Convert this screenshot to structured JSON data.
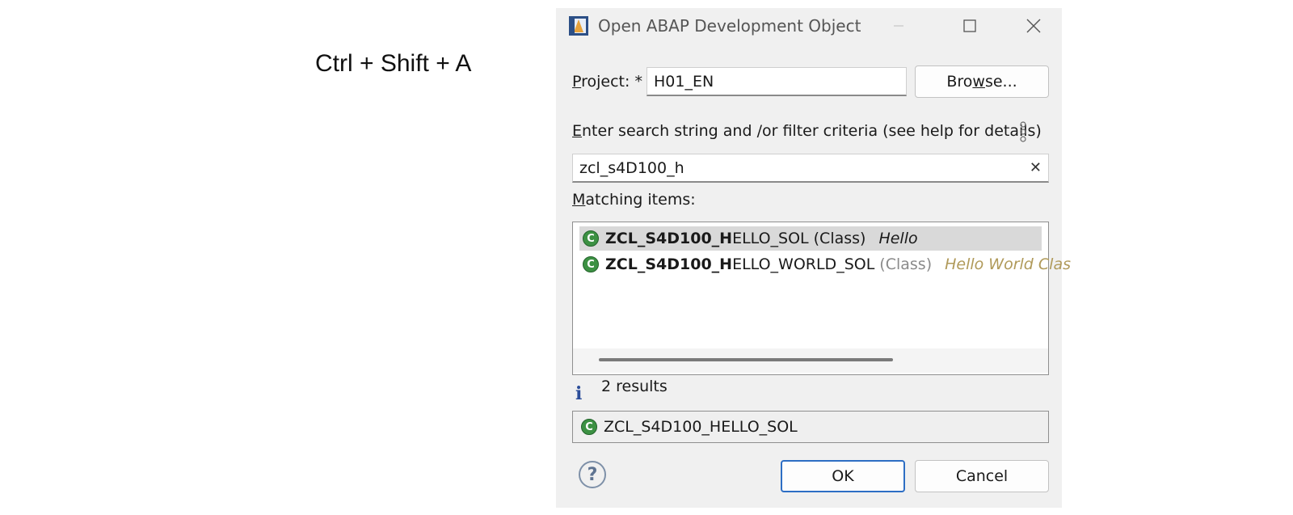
{
  "shortcut": "Ctrl + Shift + A",
  "dialog": {
    "title": "Open ABAP Development Object",
    "window_buttons": {
      "minimize": "–",
      "maximize": "☐",
      "close": "✕"
    },
    "project": {
      "label_mnemonic": "P",
      "label_rest": "roject: *",
      "value": "H01_EN"
    },
    "browse": {
      "pre": "Bro",
      "mnemonic": "w",
      "post": "se..."
    },
    "search": {
      "label_mnemonic": "E",
      "label_rest": "nter search string and /or filter criteria (see help for details)",
      "value": "zcl_s4D100_h",
      "clear_icon": "✕",
      "options_icon": "kebab-menu-icon"
    },
    "matching": {
      "label_mnemonic": "M",
      "label_rest": "atching items:",
      "items": [
        {
          "icon": "C",
          "match": "ZCL_S4D100_H",
          "rest": "ELLO_SOL",
          "type": "(Class)",
          "description": "Hello"
        },
        {
          "icon": "C",
          "match": "ZCL_S4D100_H",
          "rest": "ELLO_WORLD_SOL",
          "type": "(Class)",
          "description": "Hello World Clas"
        }
      ]
    },
    "status": {
      "icon": "i",
      "text": "2 results"
    },
    "selected": {
      "icon": "C",
      "text": "ZCL_S4D100_HELLO_SOL"
    },
    "help_icon": "?",
    "buttons": {
      "ok": "OK",
      "cancel": "Cancel"
    },
    "colors": {
      "accent": "#2d6ec4",
      "class_icon": "#3c9143",
      "selected_row": "#d9d9d9",
      "info": "#2b4d99",
      "description_muted": "#b09a5a"
    }
  }
}
